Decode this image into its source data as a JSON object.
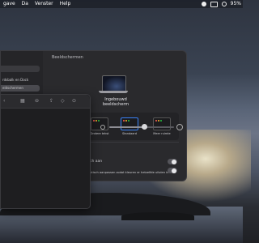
{
  "menubar": {
    "items": [
      "gave",
      "Da",
      "Venster",
      "Help"
    ],
    "battery": "95%",
    "icons": [
      "control-center-icon",
      "siri-icon",
      "wifi-icon",
      "search-icon"
    ]
  },
  "settings_window": {
    "title": "Beeldschermen",
    "sidebar": {
      "items": [
        "",
        "",
        "rdsbalk en Dock",
        "eldschermen"
      ],
      "selected_index": 3
    },
    "display_name": "Ingebouwd beeldscherm",
    "resolution_options": [
      "Meer ruimte",
      "Standaard",
      "Meer ruimte"
    ],
    "resolution_selected": "Standaard",
    "resolution_left_label": "Grotere tekst",
    "row1_label": "ch aan",
    "row2_label": "utisch aanpassen zodat kleuren er hetzelfde uitzien in",
    "colors": {
      "accent": "#3a82f7",
      "dot_red": "#ff5f57",
      "dot_yellow": "#febc2e",
      "dot_green": "#28c840"
    }
  },
  "front_window": {
    "toolbar_icons": [
      "chevron-icon",
      "view-grid-icon",
      "group-icon",
      "share-icon",
      "tag-icon",
      "action-icon"
    ]
  }
}
